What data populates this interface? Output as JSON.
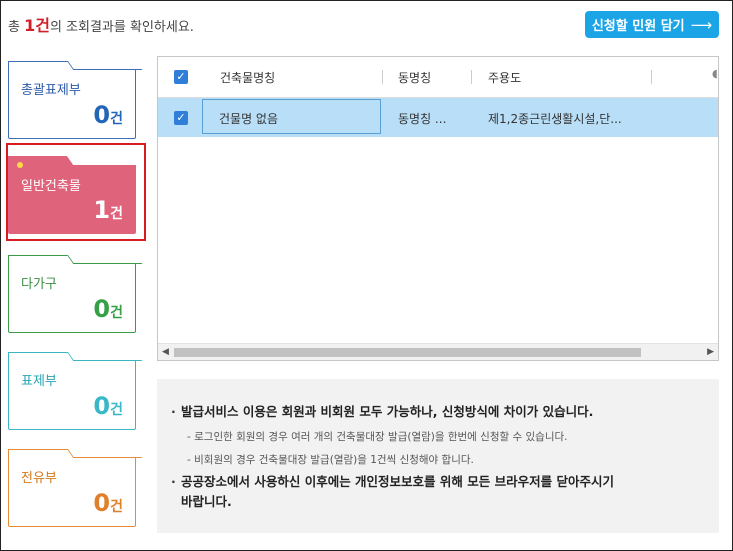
{
  "summary": {
    "prefix": "총 ",
    "count": "1건",
    "suffix": "의 조회결과를 확인하세요."
  },
  "apply_button": {
    "label": "신청할 민원 담기",
    "arrow": "⟶"
  },
  "categories": [
    {
      "label": "총괄표제부",
      "count": "0",
      "unit": "건"
    },
    {
      "label": "일반건축물",
      "count": "1",
      "unit": "건"
    },
    {
      "label": "다가구",
      "count": "0",
      "unit": "건"
    },
    {
      "label": "표제부",
      "count": "0",
      "unit": "건"
    },
    {
      "label": "전유부",
      "count": "0",
      "unit": "건"
    }
  ],
  "grid": {
    "headers": [
      "건축물명칭",
      "동명칭",
      "주용도"
    ],
    "rows": [
      {
        "checked": true,
        "name": "건물명 없음",
        "dong": "동명칭 ...",
        "use": "제1,2종근린생활시설,단..."
      }
    ]
  },
  "notice": {
    "item1": "발급서비스 이용은 회원과 비회원 모두 가능하나, 신청방식에 차이가 있습니다.",
    "sub1": "- 로그인한 회원의 경우 여러 개의 건축물대장 발급(열람)을 한번에 신청할 수 있습니다.",
    "sub2": "- 비회원의 경우 건축물대장 발급(열람)을 1건씩 신청해야 합니다.",
    "item2_line1": "공공장소에서 사용하신 이후에는 개인정보보호를 위해 모든 브라우저를 닫아주시기",
    "item2_line2": "바랍니다."
  },
  "colors": {
    "accent": "#1ba4e6",
    "selected_card": "#e0637c",
    "selection_outline": "#d81b23",
    "row_selected": "#b9def7"
  }
}
